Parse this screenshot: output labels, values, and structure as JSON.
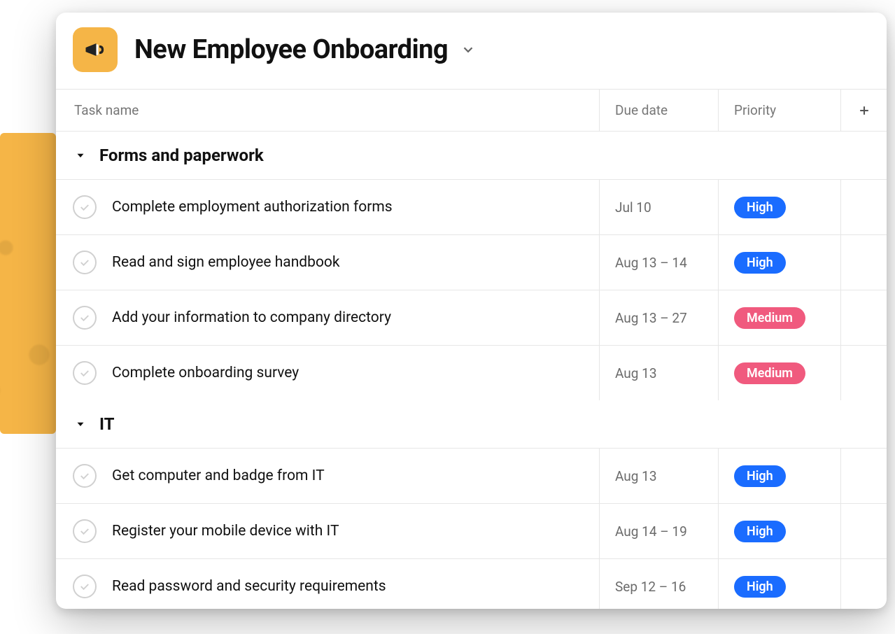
{
  "project": {
    "title": "New Employee Onboarding",
    "icon": "megaphone-icon"
  },
  "columns": {
    "name": "Task name",
    "due": "Due date",
    "priority": "Priority"
  },
  "priority_labels": {
    "high": "High",
    "medium": "Medium"
  },
  "sections": [
    {
      "title": "Forms and paperwork",
      "tasks": [
        {
          "name": "Complete employment authorization forms",
          "due": "Jul 10",
          "priority": "high"
        },
        {
          "name": "Read and sign employee handbook",
          "due": "Aug 13 – 14",
          "priority": "high"
        },
        {
          "name": "Add your information to company directory",
          "due": "Aug 13 – 27",
          "priority": "medium"
        },
        {
          "name": "Complete onboarding survey",
          "due": "Aug 13",
          "priority": "medium"
        }
      ]
    },
    {
      "title": "IT",
      "tasks": [
        {
          "name": "Get computer and badge from IT",
          "due": "Aug 13",
          "priority": "high"
        },
        {
          "name": "Register your mobile device with IT",
          "due": "Aug 14 – 19",
          "priority": "high"
        },
        {
          "name": "Read password and security requirements",
          "due": "Sep 12 – 16",
          "priority": "high"
        }
      ]
    }
  ]
}
